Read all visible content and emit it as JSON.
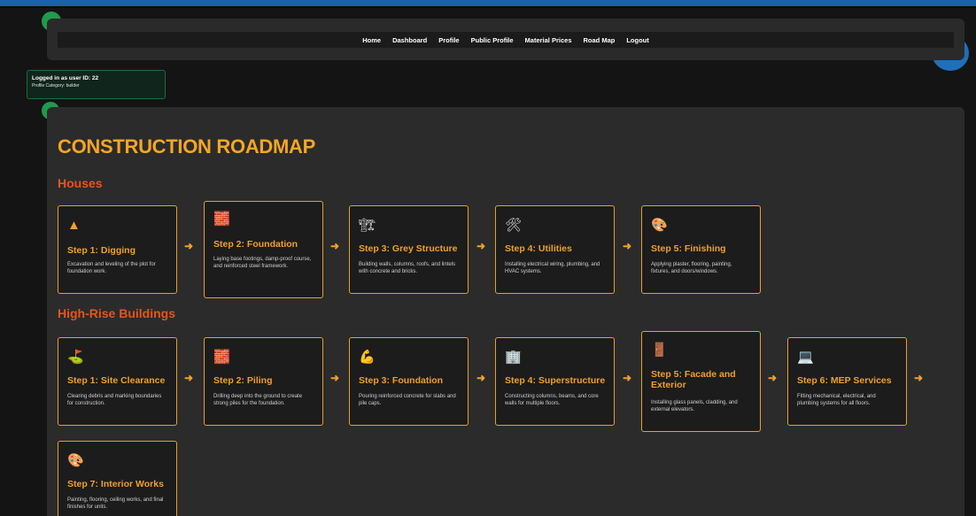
{
  "nav": {
    "items": [
      "Home",
      "Dashboard",
      "Profile",
      "Public Profile",
      "Material Prices",
      "Road Map",
      "Logout"
    ]
  },
  "login": {
    "user_line": "Logged in as user ID: 22",
    "category_line": "Profile Category: builder"
  },
  "page": {
    "title": "CONSTRUCTION ROADMAP"
  },
  "houses": {
    "title": "Houses",
    "steps": [
      {
        "icon": "cone-icon",
        "glyph": "▲",
        "title": "Step 1: Digging",
        "desc": "Excavation and leveling of the plot for foundation work."
      },
      {
        "icon": "brick-icon",
        "glyph": "🧱",
        "title": "Step 2: Foundation",
        "desc": "Laying base footings, damp-proof course, and reinforced steel framework."
      },
      {
        "icon": "construction-site-icon",
        "glyph": "🏗",
        "title": "Step 3: Grey Structure",
        "desc": "Building walls, columns, roofs, and lintels with concrete and bricks."
      },
      {
        "icon": "tools-icon",
        "glyph": "🛠",
        "title": "Step 4: Utilities",
        "desc": "Installing electrical wiring, plumbing, and HVAC systems."
      },
      {
        "icon": "palette-icon",
        "glyph": "🎨",
        "title": "Step 5: Finishing",
        "desc": "Applying plaster, flooring, painting, fixtures, and doors/windows."
      }
    ]
  },
  "highrise": {
    "title": "High-Rise Buildings",
    "steps": [
      {
        "icon": "flag-icon",
        "glyph": "⛳",
        "title": "Step 1: Site Clearance",
        "desc": "Clearing debris and marking boundaries for construction."
      },
      {
        "icon": "brick-icon",
        "glyph": "🧱",
        "title": "Step 2: Piling",
        "desc": "Drilling deep into the ground to create strong piles for the foundation."
      },
      {
        "icon": "muscle-icon",
        "glyph": "💪",
        "title": "Step 3: Foundation",
        "desc": "Pouring reinforced concrete for slabs and pile caps."
      },
      {
        "icon": "building-icon",
        "glyph": "🏢",
        "title": "Step 4: Superstructure",
        "desc": "Constructing columns, beams, and core walls for multiple floors."
      },
      {
        "icon": "door-icon",
        "glyph": "🚪",
        "title": "Step 5: Facade and Exterior",
        "desc": "Installing glass panels, cladding, and external elevators."
      },
      {
        "icon": "laptop-icon",
        "glyph": "💻",
        "title": "Step 6: MEP Services",
        "desc": "Fitting mechanical, electrical, and plumbing systems for all floors."
      },
      {
        "icon": "palette-icon",
        "glyph": "🎨",
        "title": "Step 7: Interior Works",
        "desc": "Painting, flooring, ceiling works, and final finishes for units."
      }
    ]
  },
  "arrow": "➜",
  "colors": {
    "accent": "#f5a623",
    "section": "#e8541a",
    "nav_bg": "#2a2a2a",
    "card_bg": "#1c1c1c"
  }
}
